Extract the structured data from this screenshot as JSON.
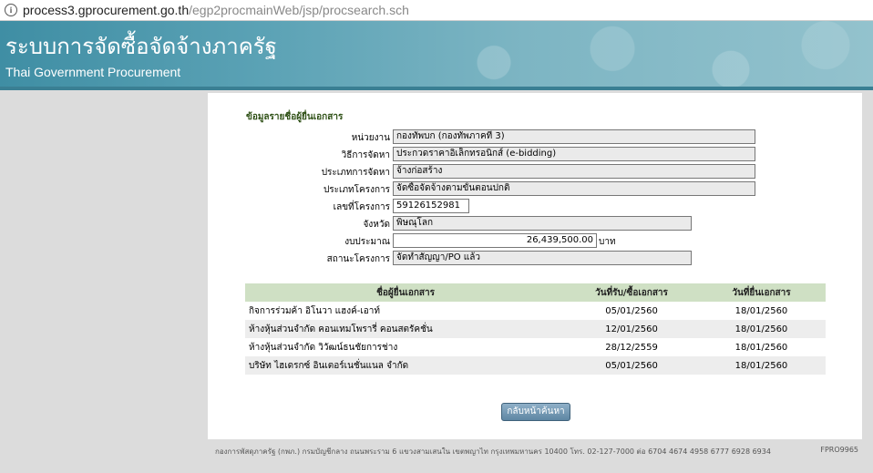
{
  "browser": {
    "url_domain": "process3.gprocurement.go.th",
    "url_path": "/egp2procmainWeb/jsp/procsearch.sch"
  },
  "header": {
    "title_th": "ระบบการจัดซื้อจัดจ้างภาครัฐ",
    "title_en": "Thai Government Procurement"
  },
  "section": {
    "title": "ข้อมูลรายชื่อผู้ยื่นเอกสาร"
  },
  "fields": [
    {
      "label": "หน่วยงาน",
      "value": "กองทัพบก (กองทัพภาคที่ 3)"
    },
    {
      "label": "วิธีการจัดหา",
      "value": "ประกวดราคาอิเล็กทรอนิกส์ (e-bidding)"
    },
    {
      "label": "ประเภทการจัดหา",
      "value": "จ้างก่อสร้าง"
    },
    {
      "label": "ประเภทโครงการ",
      "value": "จัดซื้อจัดจ้างตามขั้นตอนปกติ"
    },
    {
      "label": "เลขที่โครงการ",
      "value": "59126152981"
    },
    {
      "label": "จังหวัด",
      "value": "พิษณุโลก"
    },
    {
      "label": "งบประมาณ",
      "value": "26,439,500.00",
      "unit": "บาท"
    },
    {
      "label": "สถานะโครงการ",
      "value": "จัดทำสัญญา/PO แล้ว"
    }
  ],
  "table": {
    "headers": [
      "ชื่อผู้ยื่นเอกสาร",
      "วันที่รับ/ซื้อเอกสาร",
      "วันที่ยื่นเอกสาร"
    ],
    "rows": [
      [
        "กิจการร่วมค้า อิโนวา แฮงค์-เอาท์",
        "05/01/2560",
        "18/01/2560"
      ],
      [
        "ห้างหุ้นส่วนจำกัด คอนเทมโพรารี่ คอนสตรัคชั่น",
        "12/01/2560",
        "18/01/2560"
      ],
      [
        "ห้างหุ้นส่วนจำกัด วิวัฒน์ธนชัยการช่าง",
        "28/12/2559",
        "18/01/2560"
      ],
      [
        "บริษัท ไฮเดรกซ์ อินเตอร์เนชั่นแนล จำกัด",
        "05/01/2560",
        "18/01/2560"
      ]
    ]
  },
  "actions": {
    "back_label": "กลับหน้าค้นหา"
  },
  "footer": {
    "text": "กองการพัสดุภาครัฐ (กพภ.) กรมบัญชีกลาง ถนนพระราม 6 แขวงสามเสนใน เขตพญาไท กรุงเทพมหานคร 10400 โทร. 02-127-7000 ต่อ 6704 4674 4958 6777 6928 6934",
    "code": "FPRO9965"
  }
}
